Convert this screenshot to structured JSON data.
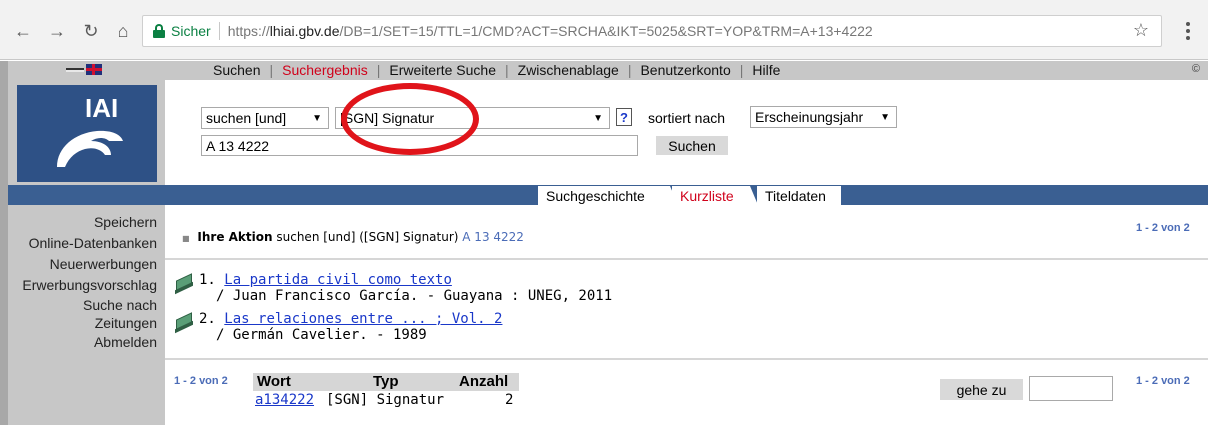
{
  "browser": {
    "secure_label": "Sicher",
    "url_scheme": "https://",
    "url_host": "lhiai.gbv.de",
    "url_path": "/DB=1/SET=15/TTL=1/CMD?ACT=SRCHA&IKT=5025&SRT=YOP&TRM=A+13+4222"
  },
  "topnav": {
    "items": [
      "Suchen",
      "Suchergebnis",
      "Erweiterte Suche",
      "Zwischenablage",
      "Benutzerkonto",
      "Hilfe"
    ],
    "active": "Suchergebnis",
    "copyright": "©"
  },
  "logo": {
    "text": "IAI"
  },
  "search": {
    "operator": "suchen [und]",
    "field": "[SGN] Signatur",
    "help": "?",
    "sort_label": "sortiert nach",
    "sort_value": "Erscheinungsjahr",
    "query": "A 13 4222",
    "submit": "Suchen"
  },
  "tabs": [
    "Suchgeschichte",
    "Kurzliste",
    "Titeldaten"
  ],
  "active_tab": "Kurzliste",
  "left_menu": [
    "Speichern",
    "Online-Datenbanken",
    "Neuerwerbungen",
    "Erwerbungsvorschlag",
    "Suche nach",
    "Zeitungen",
    "Abmelden"
  ],
  "action": {
    "label": "Ihre Aktion",
    "text": "suchen [und] ([SGN] Signatur)",
    "query": "A 13 4222"
  },
  "pagecount": "1 - 2 von 2",
  "results": [
    {
      "num": "1.",
      "title": "La partida civil como texto",
      "details": "/ Juan Francisco García. - Guayana : UNEG, 2011"
    },
    {
      "num": "2.",
      "title": "Las relaciones entre ... ; Vol. 2",
      "details": "/ Germán Cavelier. - 1989"
    }
  ],
  "word_table": {
    "headers": [
      "Wort",
      "Typ",
      "Anzahl"
    ],
    "rows": [
      {
        "wort": "a134222",
        "typ": "[SGN] Signatur",
        "anzahl": "2"
      }
    ]
  },
  "goto_label": "gehe zu",
  "colors": {
    "band": "#3a5f92",
    "accent_red": "#d0021b",
    "link": "#1a38c9",
    "annotation_circle": "#e0141a"
  }
}
